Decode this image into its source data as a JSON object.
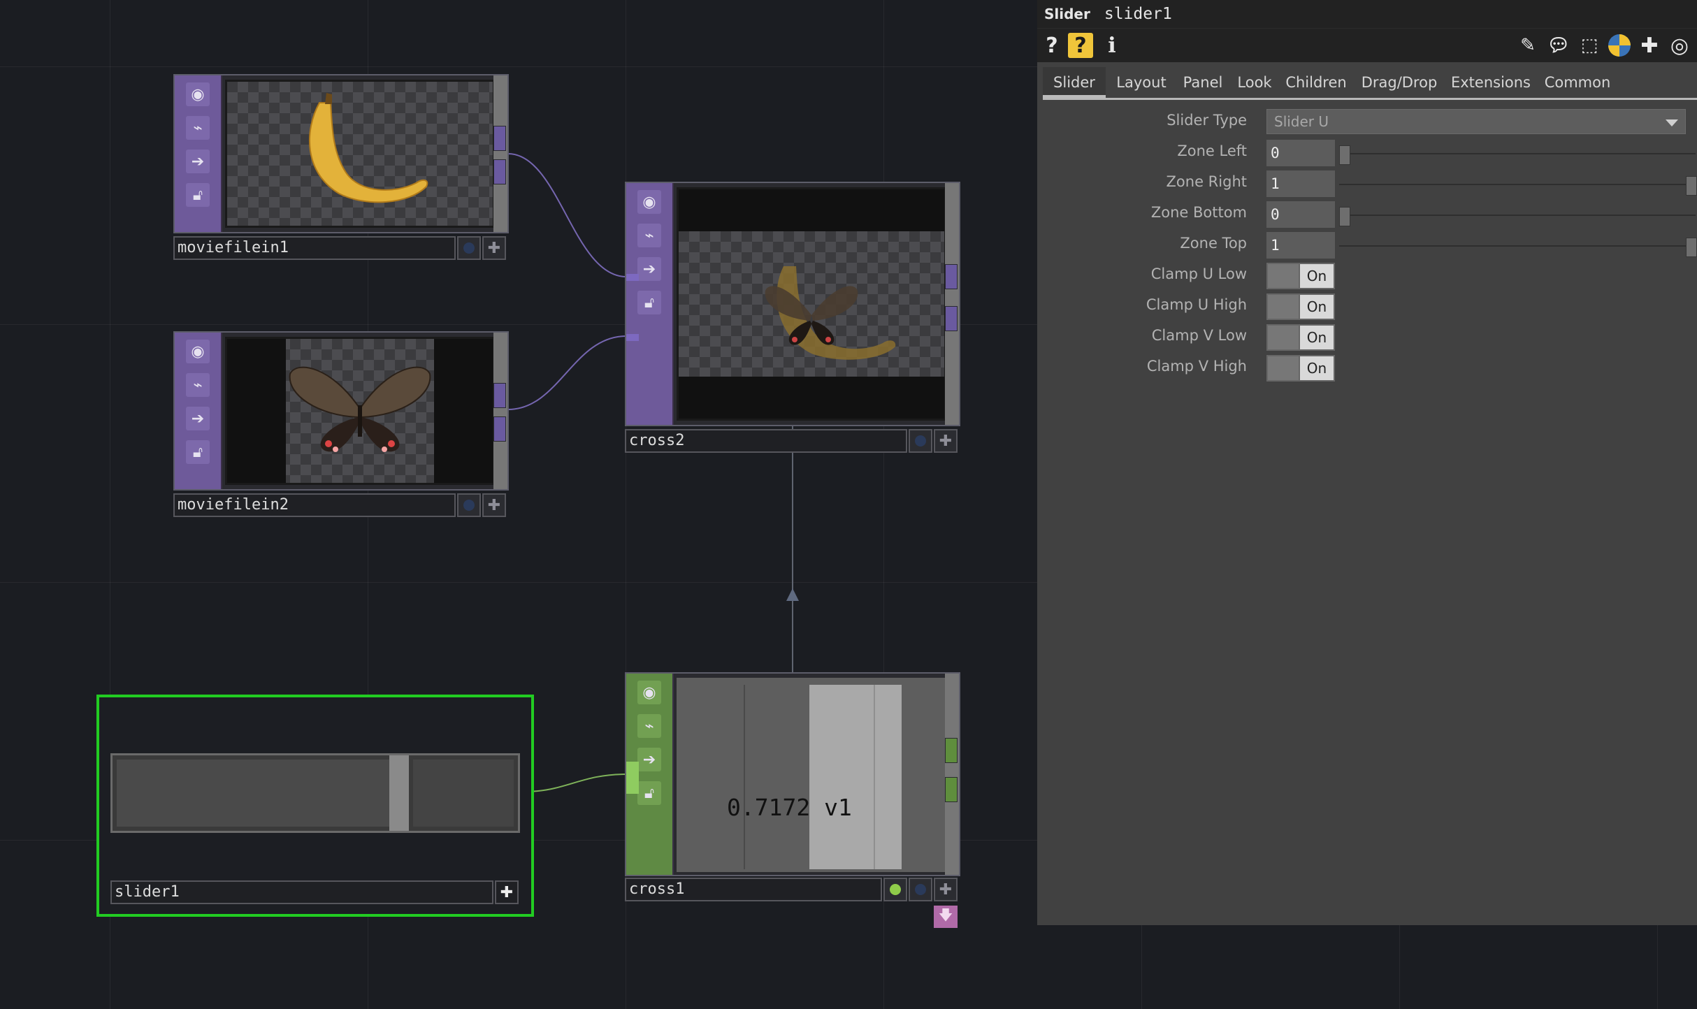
{
  "nodes": {
    "moviefilein1": {
      "name": "moviefilein1",
      "icon": "banana-image"
    },
    "moviefilein2": {
      "name": "moviefilein2",
      "icon": "butterfly-image"
    },
    "cross2": {
      "name": "cross2",
      "icon": "banana-butterfly-blend-image"
    },
    "cross1": {
      "name": "cross1",
      "value": "0.7172",
      "channel": "v1"
    },
    "slider1": {
      "name": "slider1",
      "value": 0.7172
    }
  },
  "side_icons": [
    "viewer-icon",
    "cook-icon",
    "bypass-icon",
    "lock-icon"
  ],
  "panel": {
    "type": "Slider",
    "name": "slider1",
    "tools_left": [
      "?",
      "?",
      "i"
    ],
    "tools_right": [
      "pencil-icon",
      "comment-icon",
      "clone-icon",
      "python-icon",
      "plus-icon",
      "target-icon"
    ],
    "tabs": [
      "Slider",
      "Layout",
      "Panel",
      "Look",
      "Children",
      "Drag/Drop",
      "Extensions",
      "Common"
    ],
    "active_tab": "Slider",
    "params": {
      "slider_type": {
        "label": "Slider Type",
        "value": "Slider U"
      },
      "zone_left": {
        "label": "Zone Left",
        "value": "0",
        "level": 0
      },
      "zone_right": {
        "label": "Zone Right",
        "value": "1",
        "level": 1
      },
      "zone_bottom": {
        "label": "Zone Bottom",
        "value": "0",
        "level": 0
      },
      "zone_top": {
        "label": "Zone Top",
        "value": "1",
        "level": 1
      },
      "clamp_u_low": {
        "label": "Clamp U Low",
        "value": "On"
      },
      "clamp_u_high": {
        "label": "Clamp U High",
        "value": "On"
      },
      "clamp_v_low": {
        "label": "Clamp V Low",
        "value": "On"
      },
      "clamp_v_high": {
        "label": "Clamp V High",
        "value": "On"
      }
    }
  },
  "colors": {
    "selection": "#22cc22",
    "top_family": "#6e5a9a",
    "chop_family": "#5f8a44"
  }
}
